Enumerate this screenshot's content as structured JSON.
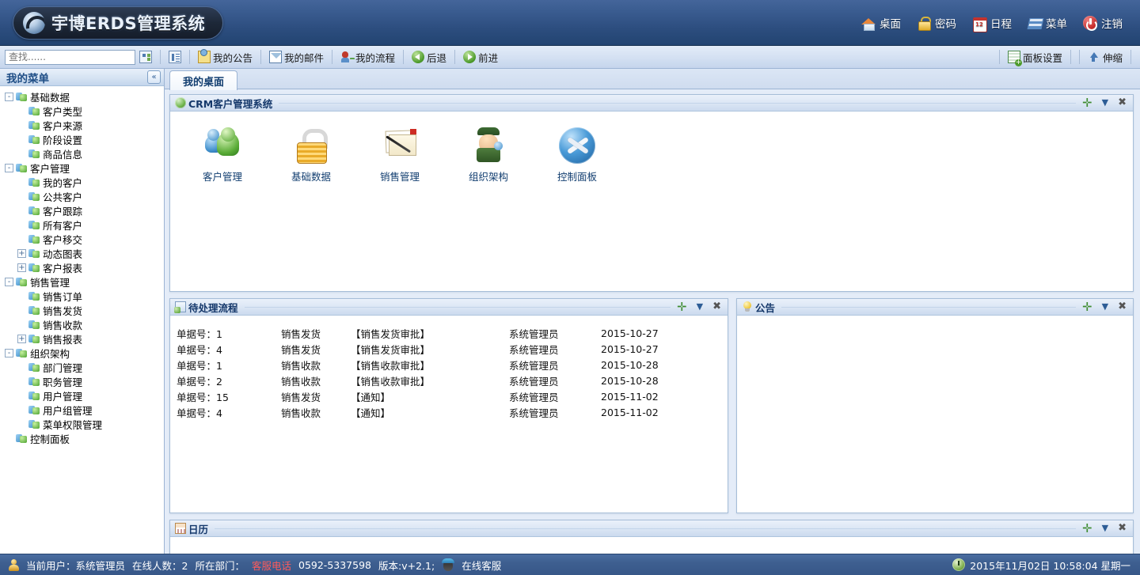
{
  "header": {
    "logo_text": "宇博ERDS管理系统",
    "nav": [
      {
        "label": "桌面",
        "icon": "home-icon"
      },
      {
        "label": "密码",
        "icon": "lock-icon"
      },
      {
        "label": "日程",
        "icon": "calendar-icon"
      },
      {
        "label": "菜单",
        "icon": "menu-icon"
      },
      {
        "label": "注销",
        "icon": "power-icon"
      }
    ]
  },
  "toolbar": {
    "search_placeholder": "查找......",
    "search_value": "",
    "buttons": [
      {
        "label": "我的公告",
        "icon": "notice-icon"
      },
      {
        "label": "我的邮件",
        "icon": "mail-icon"
      },
      {
        "label": "我的流程",
        "icon": "flow-icon"
      },
      {
        "label": "后退",
        "icon": "back-icon"
      },
      {
        "label": "前进",
        "icon": "forward-icon"
      }
    ],
    "right_buttons": [
      {
        "label": "面板设置",
        "icon": "panel-settings-icon"
      },
      {
        "label": "伸缩",
        "icon": "up-arrow-icon"
      }
    ]
  },
  "sidebar": {
    "title": "我的菜单",
    "collapse_label": "«",
    "items": [
      {
        "label": "基础数据",
        "level": 0,
        "expander": "-"
      },
      {
        "label": "客户类型",
        "level": 1,
        "expander": ""
      },
      {
        "label": "客户来源",
        "level": 1,
        "expander": ""
      },
      {
        "label": "阶段设置",
        "level": 1,
        "expander": ""
      },
      {
        "label": "商品信息",
        "level": 1,
        "expander": ""
      },
      {
        "label": "客户管理",
        "level": 0,
        "expander": "-"
      },
      {
        "label": "我的客户",
        "level": 1,
        "expander": ""
      },
      {
        "label": "公共客户",
        "level": 1,
        "expander": ""
      },
      {
        "label": "客户跟踪",
        "level": 1,
        "expander": ""
      },
      {
        "label": "所有客户",
        "level": 1,
        "expander": ""
      },
      {
        "label": "客户移交",
        "level": 1,
        "expander": ""
      },
      {
        "label": "动态图表",
        "level": 1,
        "expander": "+"
      },
      {
        "label": "客户报表",
        "level": 1,
        "expander": "+"
      },
      {
        "label": "销售管理",
        "level": 0,
        "expander": "-"
      },
      {
        "label": "销售订单",
        "level": 1,
        "expander": ""
      },
      {
        "label": "销售发货",
        "level": 1,
        "expander": ""
      },
      {
        "label": "销售收款",
        "level": 1,
        "expander": ""
      },
      {
        "label": "销售报表",
        "level": 1,
        "expander": "+"
      },
      {
        "label": "组织架构",
        "level": 0,
        "expander": "-"
      },
      {
        "label": "部门管理",
        "level": 1,
        "expander": ""
      },
      {
        "label": "职务管理",
        "level": 1,
        "expander": ""
      },
      {
        "label": "用户管理",
        "level": 1,
        "expander": ""
      },
      {
        "label": "用户组管理",
        "level": 1,
        "expander": ""
      },
      {
        "label": "菜单权限管理",
        "level": 1,
        "expander": ""
      },
      {
        "label": "控制面板",
        "level": 0,
        "expander": ""
      }
    ]
  },
  "main": {
    "tabs": [
      {
        "label": "我的桌面",
        "active": true
      }
    ],
    "panel_buttons": {
      "add": "✛",
      "minimize": "▼",
      "close": "✖"
    },
    "crm_panel": {
      "title": "CRM客户管理系统",
      "icon": "globe-icon",
      "tiles": [
        {
          "label": "客户管理",
          "icon": "users-icon"
        },
        {
          "label": "基础数据",
          "icon": "lock-icon"
        },
        {
          "label": "销售管理",
          "icon": "mail-pen-icon"
        },
        {
          "label": "组织架构",
          "icon": "soldier-icon"
        },
        {
          "label": "控制面板",
          "icon": "tools-icon"
        }
      ]
    },
    "flow_panel": {
      "title": "待处理流程",
      "icon": "flow-doc-icon",
      "rows": [
        {
          "no": "单据号：1",
          "type": "销售发货",
          "step": "【销售发货审批】",
          "user": "系统管理员",
          "date": "2015-10-27"
        },
        {
          "no": "单据号：4",
          "type": "销售发货",
          "step": "【销售发货审批】",
          "user": "系统管理员",
          "date": "2015-10-27"
        },
        {
          "no": "单据号：1",
          "type": "销售收款",
          "step": "【销售收款审批】",
          "user": "系统管理员",
          "date": "2015-10-28"
        },
        {
          "no": "单据号：2",
          "type": "销售收款",
          "step": "【销售收款审批】",
          "user": "系统管理员",
          "date": "2015-10-28"
        },
        {
          "no": "单据号：15",
          "type": "销售发货",
          "step": "【通知】",
          "user": "系统管理员",
          "date": "2015-11-02"
        },
        {
          "no": "单据号：4",
          "type": "销售收款",
          "step": "【通知】",
          "user": "系统管理员",
          "date": "2015-11-02"
        }
      ]
    },
    "notice_panel": {
      "title": "公告",
      "icon": "bulb-icon"
    },
    "calendar_panel": {
      "title": "日历",
      "icon": "calendar-desk-icon"
    }
  },
  "statusbar": {
    "current_user_label": "当前用户：系统管理员",
    "online_count_label": "在线人数：2",
    "department_label": "所在部门：",
    "hotline_label": "客服电话",
    "hotline_number": "0592-5337598",
    "version_label": "版本:v+2.1;",
    "support_label": "在线客服",
    "datetime": "2015年11月02日 10:58:04 星期一"
  },
  "colors": {
    "header_top": "#44659a",
    "header_bottom": "#224471",
    "accent_blue": "#15386b",
    "hotline_red": "#ff5b5b",
    "status_bar": "#3e5f90"
  }
}
